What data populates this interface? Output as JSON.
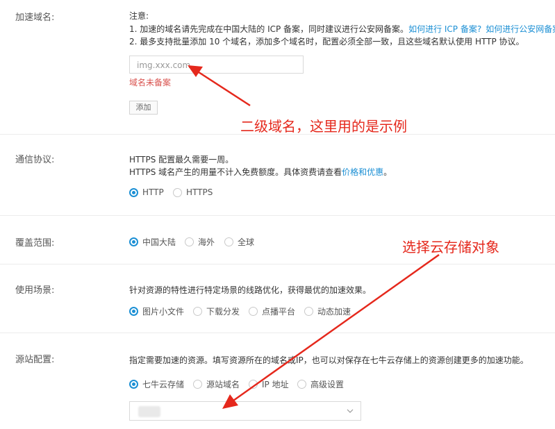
{
  "domain_section": {
    "label": "加速域名:",
    "note_title": "注意:",
    "note_line1_prefix": "1. 加速的域名请先完成在中国大陆的 ICP 备案，同时建议进行公安网备案。",
    "note_link1": "如何进行 ICP 备案?",
    "note_link2": "如何进行公安网备案?",
    "note_line2": "2. 最多支持批量添加 10 个域名，添加多个域名时，配置必须全部一致，且这些域名默认使用 HTTP 协议。",
    "input_value": "img.xxx.com",
    "error_text": "域名未备案",
    "add_button": "添加",
    "annotation": "二级域名，这里用的是示例"
  },
  "protocol_section": {
    "label": "通信协议:",
    "line1": "HTTPS 配置最久需要一周。",
    "line2_prefix": "HTTPS 域名产生的用量不计入免费额度。具体资费请查看",
    "line2_link": "价格和优惠",
    "line2_suffix": "。",
    "options": [
      "HTTP",
      "HTTPS"
    ],
    "selected": "HTTP"
  },
  "coverage_section": {
    "label": "覆盖范围:",
    "options": [
      "中国大陆",
      "海外",
      "全球"
    ],
    "selected": "中国大陆",
    "annotation": "选择云存储对象"
  },
  "scenario_section": {
    "label": "使用场景:",
    "description": "针对资源的特性进行特定场景的线路优化，获得最优的加速效果。",
    "options": [
      "图片小文件",
      "下载分发",
      "点播平台",
      "动态加速"
    ],
    "selected": "图片小文件"
  },
  "origin_section": {
    "label": "源站配置:",
    "description": "指定需要加速的资源。填写资源所在的域名或IP，也可以对保存在七牛云存储上的资源创建更多的加速功能。",
    "options": [
      "七牛云存储",
      "源站域名",
      "IP 地址",
      "高级设置"
    ],
    "selected": "七牛云存储",
    "select_icon": "chevron-down-icon"
  },
  "colors": {
    "accent": "#1b8fd4",
    "annotation": "#e5281c",
    "error": "#d9534f"
  }
}
